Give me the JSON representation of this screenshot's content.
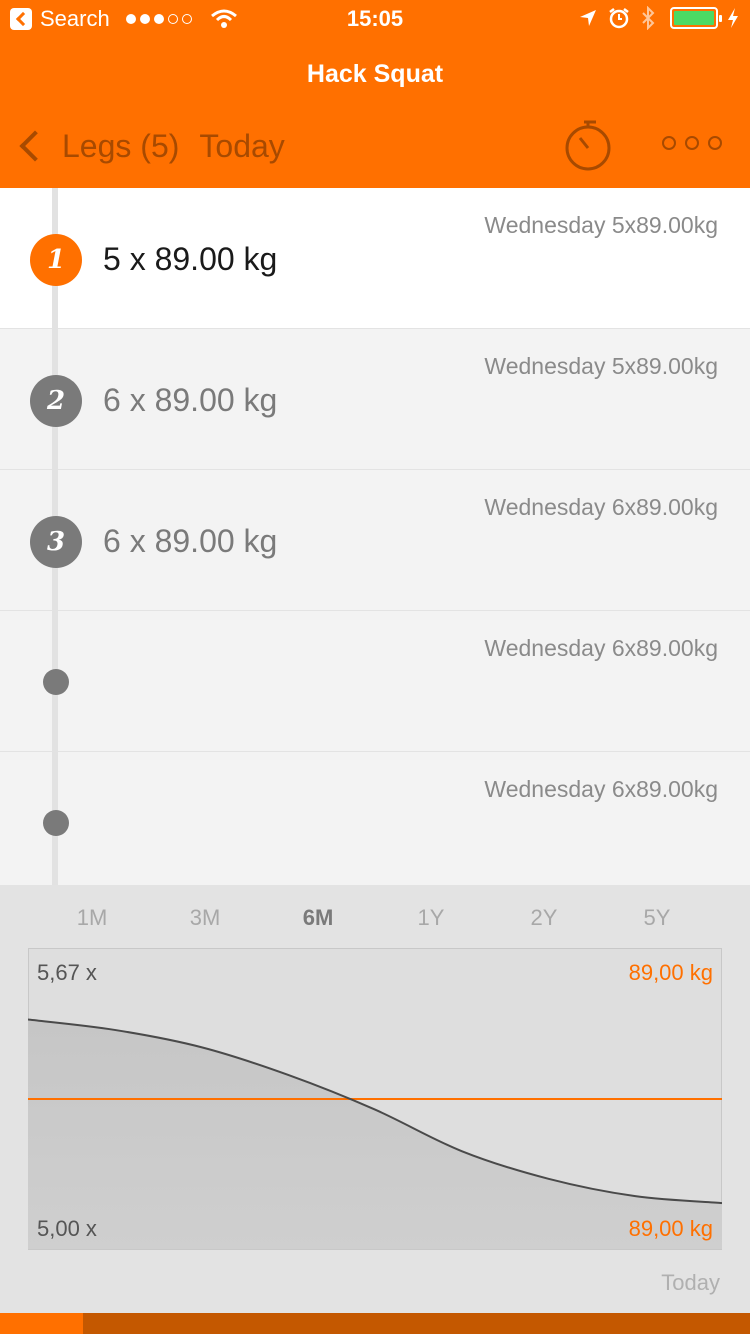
{
  "status_bar": {
    "back_app": "Search",
    "time": "15:05",
    "signal_filled": 3,
    "signal_total": 5,
    "battery_color": "#4cd964"
  },
  "nav": {
    "title": "Hack Squat",
    "back_label": "Legs (5)",
    "today_label": "Today",
    "timer_icon": "stopwatch-icon",
    "more_icon": "more-dots-icon"
  },
  "theme": {
    "accent": "#ff7000",
    "accent_dark": "#a84a00"
  },
  "sets": [
    {
      "number": "1",
      "value": "5 x 89.00 kg",
      "previous": "Wednesday 5x89.00kg",
      "active": true
    },
    {
      "number": "2",
      "value": "6 x 89.00 kg",
      "previous": "Wednesday 5x89.00kg",
      "active": false
    },
    {
      "number": "3",
      "value": "6 x 89.00 kg",
      "previous": "Wednesday 6x89.00kg",
      "active": false
    },
    {
      "number": "",
      "value": "",
      "previous": "Wednesday 6x89.00kg",
      "active": false
    },
    {
      "number": "",
      "value": "",
      "previous": "Wednesday 6x89.00kg",
      "active": false
    }
  ],
  "ranges": [
    "1M",
    "3M",
    "6M",
    "1Y",
    "2Y",
    "5Y"
  ],
  "selected_range": "6M",
  "chart": {
    "reps_max_label": "5,67 x",
    "reps_min_label": "5,00 x",
    "weight_max_label": "89,00 kg",
    "weight_min_label": "89,00 kg",
    "footer": "Today"
  },
  "chart_data": {
    "type": "line",
    "series": [
      {
        "values": [
          5.55,
          5.52,
          5.47,
          5.39,
          5.29,
          5.17,
          5.09,
          5.04,
          5.02
        ]
      },
      {
        "values": [
          89,
          89,
          89,
          89,
          89,
          89,
          89,
          89,
          89
        ]
      }
    ],
    "y_left_range": [
      5.0,
      5.67
    ],
    "y_right_range": [
      89.0,
      89.0
    ],
    "grid": false
  }
}
